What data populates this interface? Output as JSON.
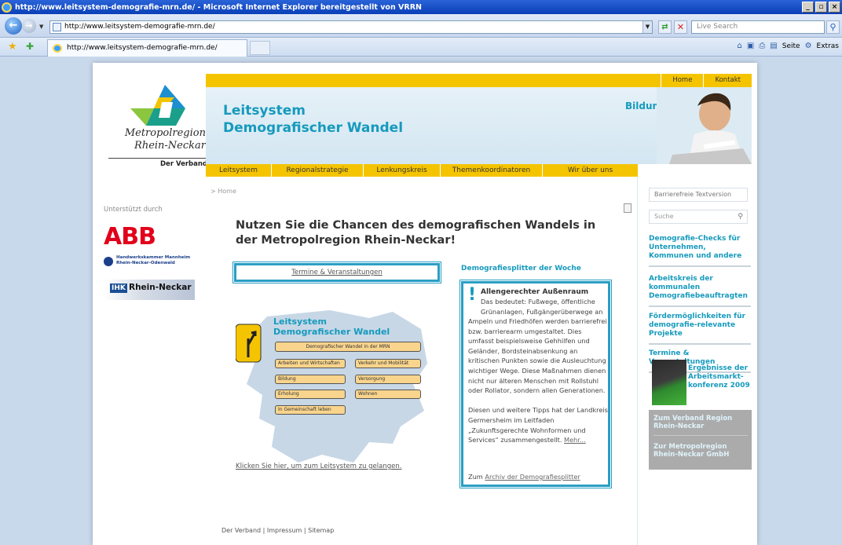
{
  "window": {
    "title": "http://www.leitsystem-demografie-mrn.de/ - Microsoft Internet Explorer bereitgestellt von VRRN",
    "min_label": "_",
    "max_label": "є",
    "close_label": "×"
  },
  "address": {
    "url": "http://www.leitsystem-demografie-mrn.de/",
    "search_placeholder": "Live Search"
  },
  "tab": {
    "label": "http://www.leitsystem-demografie-mrn.de/"
  },
  "commandbar": {
    "seite": "Seite",
    "extras": "Extras"
  },
  "logo": {
    "line1": "Metropolregion",
    "line2": "Rhein-Neckar",
    "subline": "Der Verband",
    "colors": {
      "blue": "#1c8fd0",
      "green": "#8cc63f",
      "yellow": "#f5c400",
      "teal": "#1aa08a"
    }
  },
  "sponsors": {
    "label": "Unterstützt durch",
    "abb": "ABB",
    "hwk": "Handwerkskammer Mannheim\nRhein-Neckar-Odenwald",
    "ihk_box": "IHK",
    "ihk_text": "Rhein-Neckar"
  },
  "topnav": {
    "home": "Home",
    "kontakt": "Kontakt"
  },
  "header": {
    "title_line1": "Leitsystem",
    "title_line2": "Demografischer Wandel",
    "category": "Bildung"
  },
  "mainnav": [
    "Leitsystem",
    "Regionalstrategie",
    "Lenkungskreis",
    "Themenkoordinatoren",
    "Wir über uns"
  ],
  "breadcrumb": "> Home",
  "headline": "Nutzen Sie die Chancen des demografischen Wandels in der Metropolregion Rhein-Neckar!",
  "termine_button": "Termine & Veranstaltungen",
  "leitsystem": {
    "title1": "Leitsystem",
    "title2": "Demografischer Wandel",
    "boxes": {
      "mrn": "Demografischer Wandel in der MRN",
      "arbeiten": "Arbeiten und Wirtschaften",
      "verkehr": "Verkehr und Mobilität",
      "bildung": "Bildung",
      "versorgung": "Versorgung",
      "erholung": "Erholung",
      "wohnen": "Wohnen",
      "gemeinschaft": "In Gemeinschaft leben"
    },
    "link": "Klicken Sie hier, um zum Leitsystem zu gelangen."
  },
  "news": {
    "heading": "Demografiesplitter der Woche",
    "title": "Allengerechter Außenraum",
    "lead": "Das bedeutet: Fußwege, öffentliche Grünanlagen, Fußgängerüberwege an",
    "body": "Ampeln und Friedhöfen werden barrierefrei bzw. barrierearm umgestaltet. Dies umfasst beispielsweise Gehhilfen und Geländer, Bordsteinabsenkung an kritischen Punkten sowie die Ausleuchtung wichtiger Wege. Diese Maßnahmen dienen nicht nur älteren Menschen mit Rollstuhl oder Rollator, sondern allen Generationen.",
    "body2": "Diesen und weitere Tipps hat der Landkreis Germersheim im Leitfaden „Zukunftsgerechte Wohnformen und Services“ zusammengestellt.",
    "more": "Mehr...",
    "archive_prefix": "Zum",
    "archive_link": "Archiv der Demografiesplitter"
  },
  "footer": "Der Verband | Impressum | Sitemap",
  "sidebar": {
    "barrierefrei": "Barrierefreie Textversion",
    "search_placeholder": "Suche",
    "links": [
      "Demografie-Checks für Unternehmen, Kommunen und andere",
      "Arbeitskreis der kommunalen Demografiebeauftragten",
      "Fördermöglichkeiten für demografie-relevante Projekte",
      "Termine & Veranstaltungen"
    ],
    "promo": "Ergebnisse der Arbeitsmarkt-konferenz 2009",
    "grey1": "Zum Verband Region Rhein-Neckar",
    "grey2": "Zur Metropolregion Rhein-Neckar GmbH"
  }
}
